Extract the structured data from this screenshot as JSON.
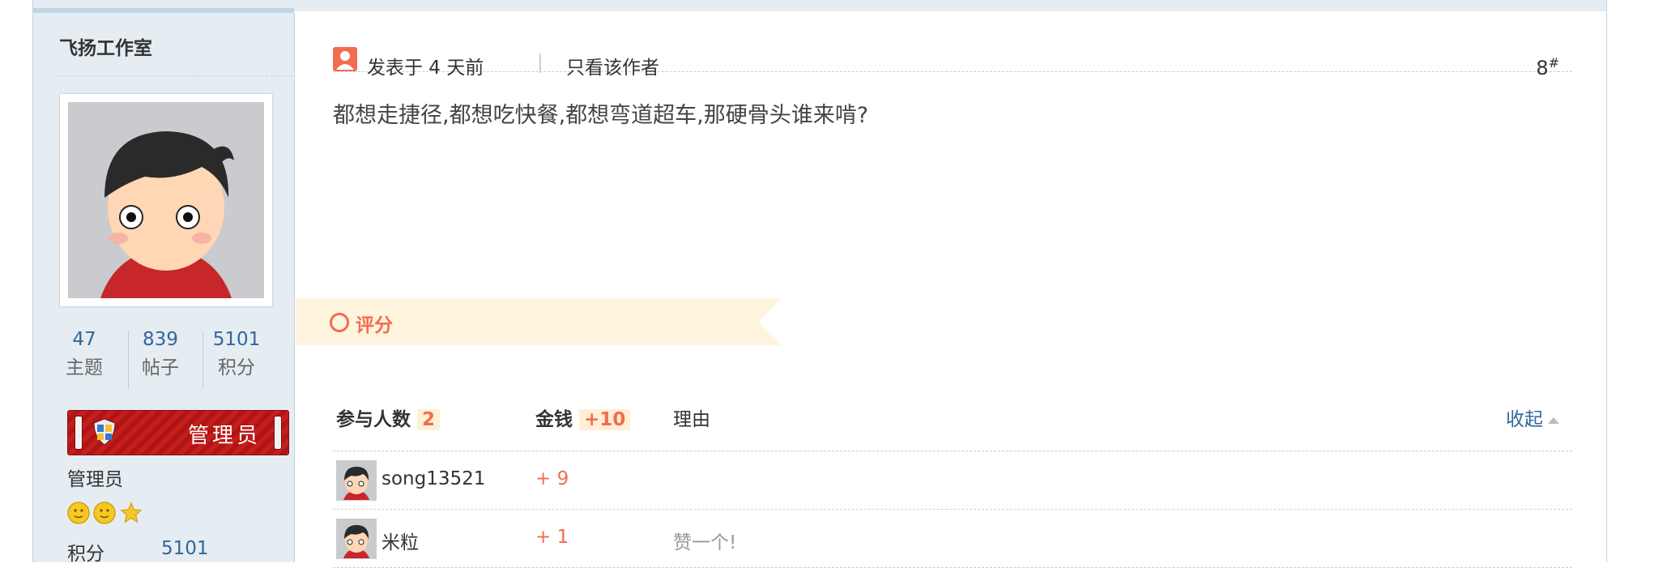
{
  "author": {
    "username": "飞扬工作室",
    "stats": [
      {
        "value": "47",
        "label": "主题"
      },
      {
        "value": "839",
        "label": "帖子"
      },
      {
        "value": "5101",
        "label": "积分"
      }
    ],
    "badge": "管理员",
    "group": "管理员",
    "points_label": "积分",
    "points_value": "5101"
  },
  "post": {
    "posted": "发表于 4 天前",
    "separator": "|",
    "only_author": "只看该作者",
    "floor": "8",
    "floor_mark": "#",
    "content": "都想走捷径,都想吃快餐,都想弯道超车,那硬骨头谁来啃?"
  },
  "rating": {
    "title": "评分",
    "participants_label": "参与人数",
    "participants_count": "2",
    "money_label": "金钱",
    "money_total": "+10",
    "reason_label": "理由",
    "collapse": "收起",
    "rows": [
      {
        "user": "song13521",
        "amount": "+ 9",
        "reason": ""
      },
      {
        "user": "米粒",
        "amount": "+ 1",
        "reason": "赞一个!"
      }
    ]
  },
  "colors": {
    "accent": "#f26c4f",
    "link": "#336699",
    "sidebar": "#e5edf2"
  }
}
